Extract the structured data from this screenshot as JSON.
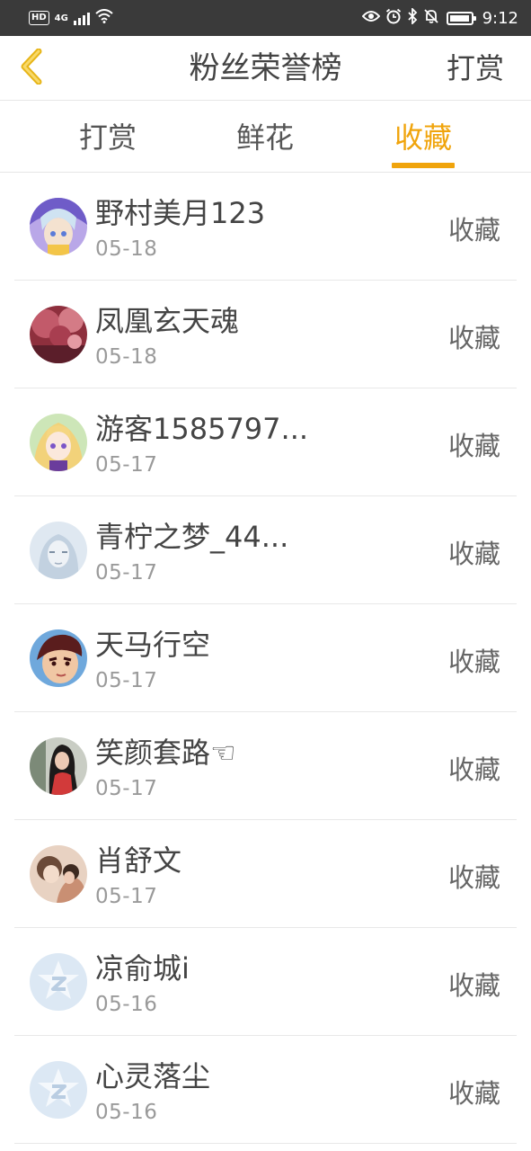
{
  "status_bar": {
    "network_badge": "HD",
    "network_type": "4G",
    "time": "9:12",
    "icons": [
      "signal-icon",
      "wifi-icon",
      "eye-icon",
      "alarm-icon",
      "bluetooth-icon",
      "mute-icon",
      "battery-icon"
    ]
  },
  "header": {
    "back_icon": "chevron-left-icon",
    "title": "粉丝荣誉榜",
    "right_action": "打赏"
  },
  "tabs": [
    {
      "label": "打赏",
      "active": false
    },
    {
      "label": "鲜花",
      "active": false
    },
    {
      "label": "收藏",
      "active": true
    }
  ],
  "colors": {
    "accent": "#f0a40c",
    "status_bar_bg": "#3a3a3a",
    "text_primary": "#444444",
    "text_secondary": "#9a9a9a",
    "divider": "#e8e8e8"
  },
  "fans": [
    {
      "name": "野村美月123",
      "date": "05-18",
      "action": "收藏",
      "avatar": "anime-avatar"
    },
    {
      "name": "凤凰玄天魂",
      "date": "05-18",
      "action": "收藏",
      "avatar": "blossom-avatar"
    },
    {
      "name": "游客1585797...",
      "date": "05-17",
      "action": "收藏",
      "avatar": "anime-avatar"
    },
    {
      "name": "青柠之梦_44...",
      "date": "05-17",
      "action": "收藏",
      "avatar": "sketch-avatar"
    },
    {
      "name": "天马行空",
      "date": "05-17",
      "action": "收藏",
      "avatar": "cartoon-avatar"
    },
    {
      "name": "笑颜套路☜",
      "date": "05-17",
      "action": "收藏",
      "avatar": "photo-avatar"
    },
    {
      "name": "肖舒文",
      "date": "05-17",
      "action": "收藏",
      "avatar": "photo-avatar"
    },
    {
      "name": "凉俞城i",
      "date": "05-16",
      "action": "收藏",
      "avatar": "default-avatar"
    },
    {
      "name": "心灵落尘",
      "date": "05-16",
      "action": "收藏",
      "avatar": "default-avatar"
    }
  ]
}
